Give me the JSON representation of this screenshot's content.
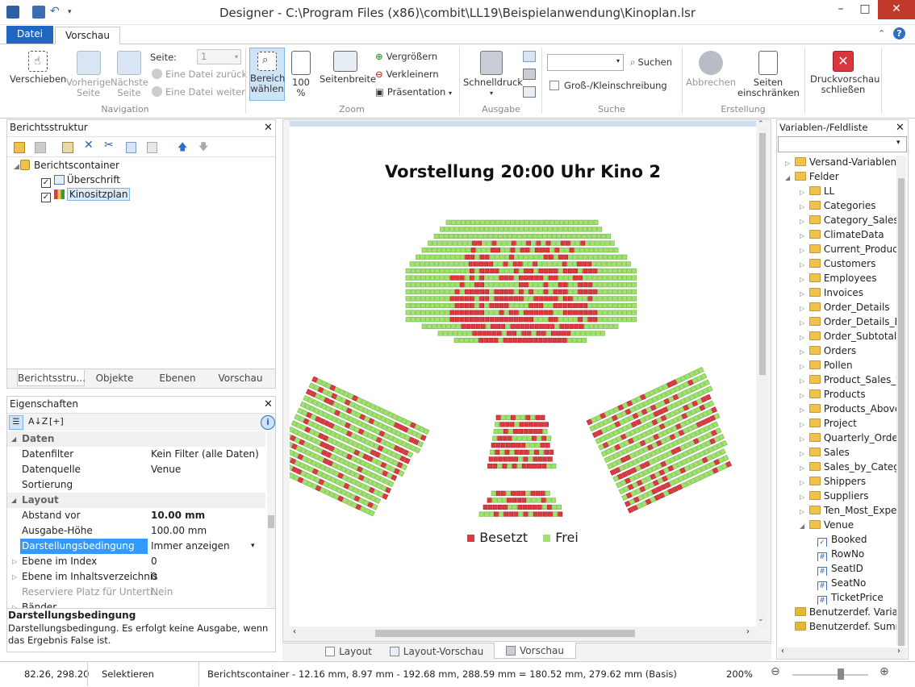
{
  "window": {
    "title": "Designer - C:\\Program Files (x86)\\combit\\LL19\\Beispielanwendung\\Kinoplan.lsr",
    "minimize": "–",
    "maximize": "□",
    "close": "✕"
  },
  "tabs": {
    "file": "Datei",
    "preview": "Vorschau"
  },
  "ribbon": {
    "navigation": {
      "group": "Navigation",
      "move": "Verschieben",
      "prev": "Vorherige\nSeite",
      "next": "Nächste\nSeite",
      "page_label": "Seite:",
      "page_value": "1",
      "file_back": "Eine Datei zurück",
      "file_forward": "Eine Datei weiter"
    },
    "zoom": {
      "group": "Zoom",
      "select_area": "Bereich\nwählen",
      "hundred": "100\n%",
      "page_width": "Seitenbreite",
      "zoom_in": "Vergrößern",
      "zoom_out": "Verkleinern",
      "presentation": "Präsentation"
    },
    "output": {
      "group": "Ausgabe",
      "quickprint": "Schnelldruck"
    },
    "search": {
      "group": "Suche",
      "search": "Suchen",
      "case": "Groß-/Kleinschreibung",
      "input": ""
    },
    "build": {
      "group": "Erstellung",
      "cancel": "Abbrechen",
      "limit_pages": "Seiten\neinschränken"
    },
    "close_preview": "Druckvorschau\nschließen"
  },
  "structure": {
    "title": "Berichtsstruktur",
    "items": [
      "Berichtscontainer",
      "Überschrift",
      "Kinositzplan"
    ],
    "tabs": [
      "Berichtsstru...",
      "Objekte",
      "Ebenen",
      "Vorschau"
    ]
  },
  "properties": {
    "title": "Eigenschaften",
    "sections": {
      "data": "Daten",
      "layout": "Layout"
    },
    "rows": [
      {
        "k": "Datenfilter",
        "v": "Kein Filter (alle Daten)"
      },
      {
        "k": "Datenquelle",
        "v": "Venue"
      },
      {
        "k": "Sortierung",
        "v": ""
      },
      {
        "k": "Abstand vor",
        "v": "10.00 mm"
      },
      {
        "k": "Ausgabe-Höhe",
        "v": "100.00 mm"
      },
      {
        "k": "Darstellungsbedingung",
        "v": "Immer anzeigen"
      },
      {
        "k": "Ebene im Index",
        "v": "0"
      },
      {
        "k": "Ebene im Inhaltsverzeichnis",
        "v": "0"
      },
      {
        "k": "Reserviere Platz für Unterti...",
        "v": "Nein"
      },
      {
        "k": "Bänder",
        "v": ""
      }
    ],
    "help_title": "Darstellungsbedingung",
    "help_text": "Darstellungsbedingung. Es erfolgt keine Ausgabe, wenn das Ergebnis False ist."
  },
  "preview": {
    "heading": "Vorstellung 20:00 Uhr Kino 2",
    "legend_booked": "Besetzt",
    "legend_free": "Frei",
    "colors": {
      "booked": "#e0383e",
      "free": "#9fe36b"
    },
    "bottom_tabs": [
      "Layout",
      "Layout-Vorschau",
      "Vorschau"
    ]
  },
  "variables": {
    "title": "Variablen-/Feldliste",
    "top": "Versand-Variablen",
    "fields": "Felder",
    "tables": [
      "LL",
      "Categories",
      "Category_Sales_",
      "ClimateData",
      "Current_Produc",
      "Customers",
      "Employees",
      "Invoices",
      "Order_Details",
      "Order_Details_Ex",
      "Order_Subtotals",
      "Orders",
      "Pollen",
      "Product_Sales_f",
      "Products",
      "Products_Above",
      "Project",
      "Quarterly_Order",
      "Sales",
      "Sales_by_Catego",
      "Shippers",
      "Suppliers",
      "Ten_Most_Exper"
    ],
    "venue": "Venue",
    "venue_fields": [
      "Booked",
      "RowNo",
      "SeatID",
      "SeatNo",
      "TicketPrice"
    ],
    "custom_vars": "Benutzerdef. Variab",
    "custom_sums": "Benutzerdef. Summ"
  },
  "status": {
    "coords": "82.26, 298.20",
    "mode": "Selektieren",
    "info": "Berichtscontainer  -  12.16 mm, 8.97 mm  -  192.68 mm, 288.59 mm  =  180.52 mm, 279.62 mm (Basis)",
    "zoom": "200%"
  }
}
